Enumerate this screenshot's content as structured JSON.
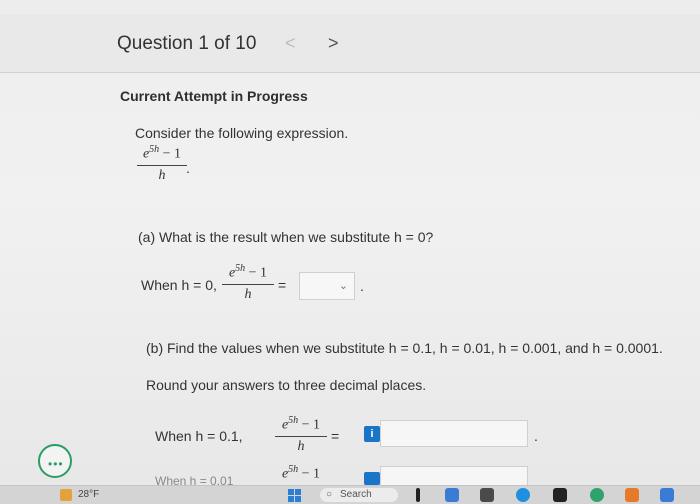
{
  "header": {
    "question_title": "Question 1 of 10",
    "prev_label": "<",
    "next_label": ">"
  },
  "attempt_heading": "Current Attempt in Progress",
  "intro": {
    "text": "Consider the following expression.",
    "expr_num": "e",
    "expr_exp": "5h",
    "expr_minus": " − 1",
    "expr_den": "h",
    "expr_end": "."
  },
  "part_a": {
    "question": "(a) What is the result when we substitute h = 0?",
    "when_label": "When h = 0,",
    "equals": "=",
    "period": "."
  },
  "part_b": {
    "question": "(b) Find the values when we substitute h = 0.1, h = 0.01, h = 0.001, and h = 0.0001.",
    "round_note": "Round your answers to three decimal places.",
    "row1_label": "When h = 0.1,",
    "row2_label": "When h = 0.01",
    "equals": "=",
    "period": "."
  },
  "info_icon_char": "i",
  "dropdown_chevron": "⌄",
  "taskbar": {
    "temperature": "28°F",
    "search_label": "Search"
  },
  "colors": {
    "accent_blue": "#1a74c7",
    "chat_green": "#2a9d63"
  }
}
